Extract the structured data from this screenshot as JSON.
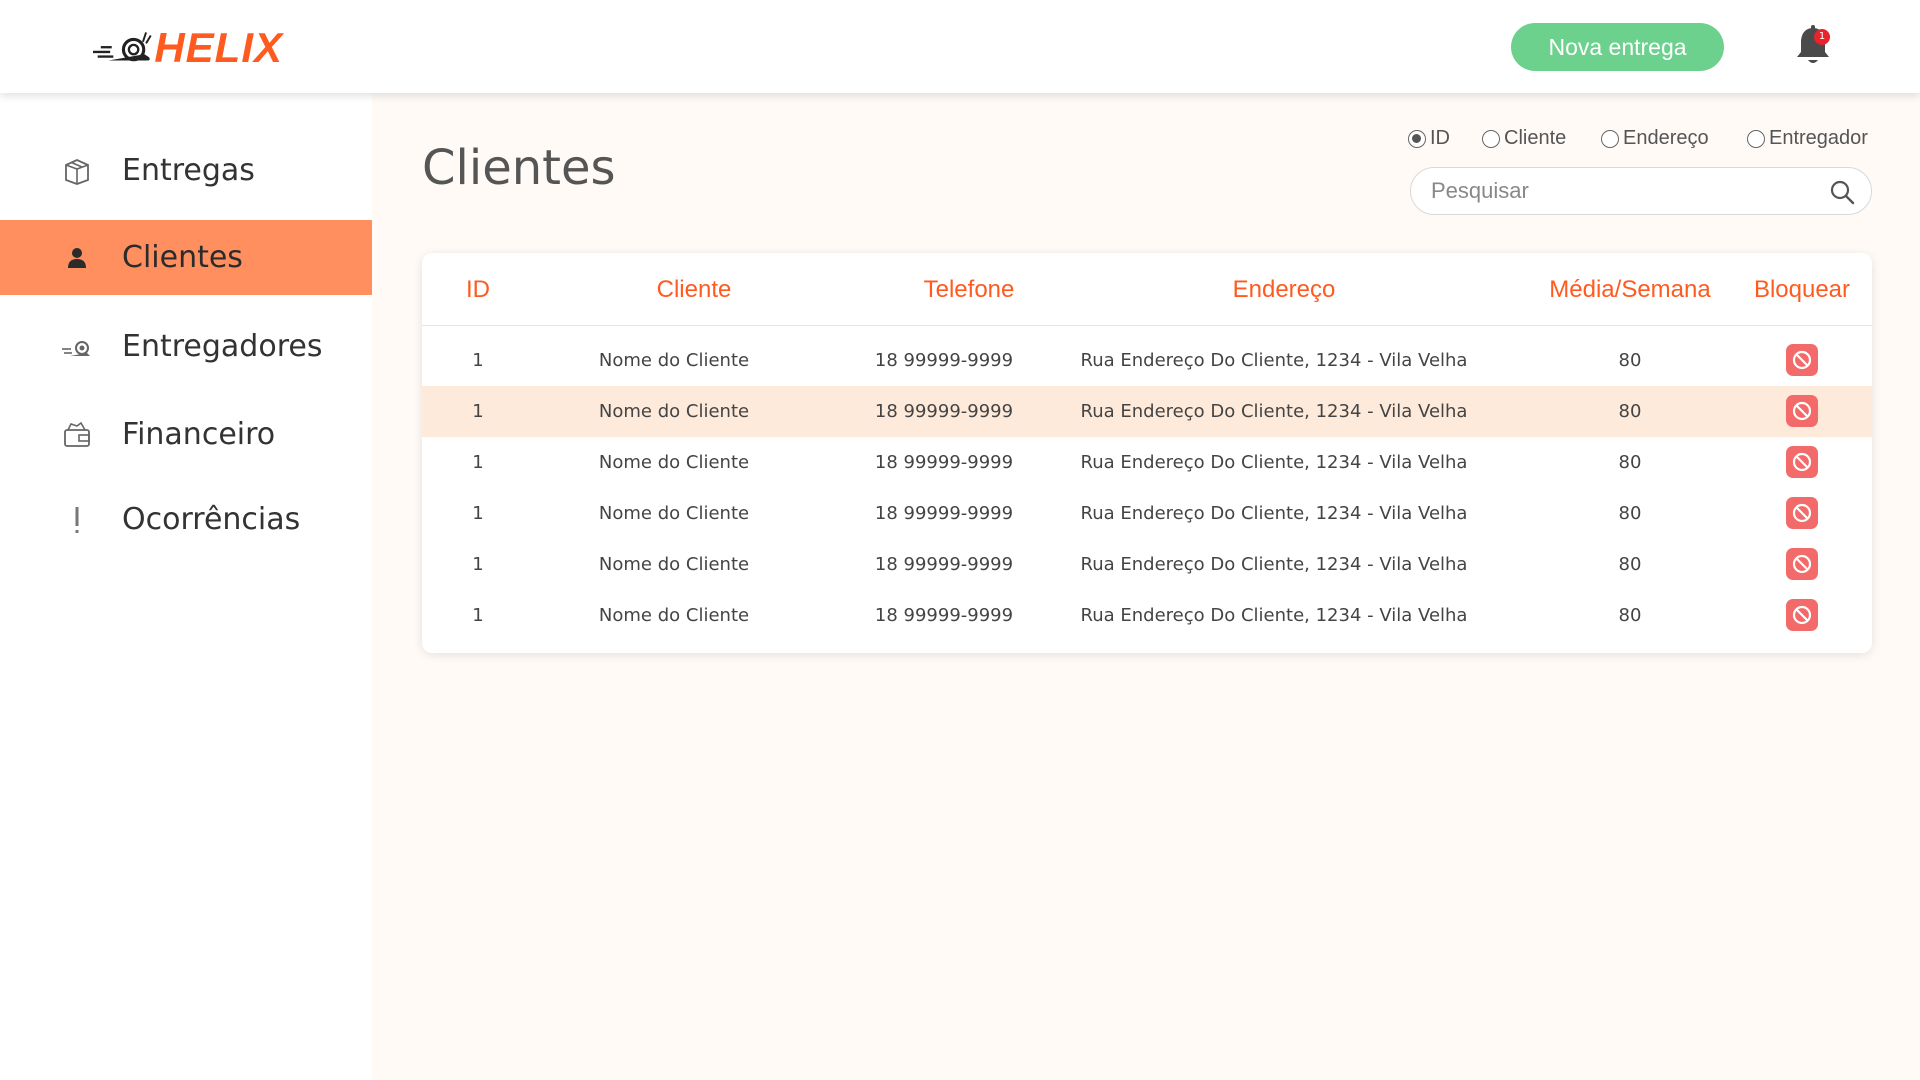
{
  "app": {
    "logo_text": "HELIX",
    "accent": "#ff5a1f"
  },
  "header": {
    "new_delivery_label": "Nova entrega",
    "new_delivery_color": "#6dd18e",
    "notification_count": "1"
  },
  "sidebar": {
    "active_color": "#ff8f5f",
    "items": [
      {
        "label": "Entregas",
        "icon": "package-icon"
      },
      {
        "label": "Clientes",
        "icon": "user-icon",
        "active": true
      },
      {
        "label": "Entregadores",
        "icon": "snail-icon"
      },
      {
        "label": "Financeiro",
        "icon": "wallet-icon"
      },
      {
        "label": "Ocorrências",
        "icon": "exclamation-icon"
      }
    ]
  },
  "page": {
    "title": "Clientes"
  },
  "filters": {
    "options": [
      "ID",
      "Cliente",
      "Endereço",
      "Entregador"
    ],
    "selected": "ID"
  },
  "search": {
    "placeholder": "Pesquisar",
    "value": ""
  },
  "table": {
    "headers": [
      "ID",
      "Cliente",
      "Telefone",
      "Endereço",
      "Média/Semana",
      "Bloquear"
    ],
    "rows": [
      {
        "id": "1",
        "cliente": "Nome do Cliente",
        "telefone": "18 99999-9999",
        "endereco": "Rua Endereço Do Cliente, 1234 - Vila Velha",
        "media": "80"
      },
      {
        "id": "1",
        "cliente": "Nome do Cliente",
        "telefone": "18 99999-9999",
        "endereco": "Rua Endereço Do Cliente, 1234 - Vila Velha",
        "media": "80",
        "highlighted": true
      },
      {
        "id": "1",
        "cliente": "Nome do Cliente",
        "telefone": "18 99999-9999",
        "endereco": "Rua Endereço Do Cliente, 1234 - Vila Velha",
        "media": "80"
      },
      {
        "id": "1",
        "cliente": "Nome do Cliente",
        "telefone": "18 99999-9999",
        "endereco": "Rua Endereço Do Cliente, 1234 - Vila Velha",
        "media": "80"
      },
      {
        "id": "1",
        "cliente": "Nome do Cliente",
        "telefone": "18 99999-9999",
        "endereco": "Rua Endereço Do Cliente, 1234 - Vila Velha",
        "media": "80"
      },
      {
        "id": "1",
        "cliente": "Nome do Cliente",
        "telefone": "18 99999-9999",
        "endereco": "Rua Endereço Do Cliente, 1234 - Vila Velha",
        "media": "80"
      }
    ],
    "block_icon": "block-icon",
    "block_color": "#f26a6a"
  }
}
